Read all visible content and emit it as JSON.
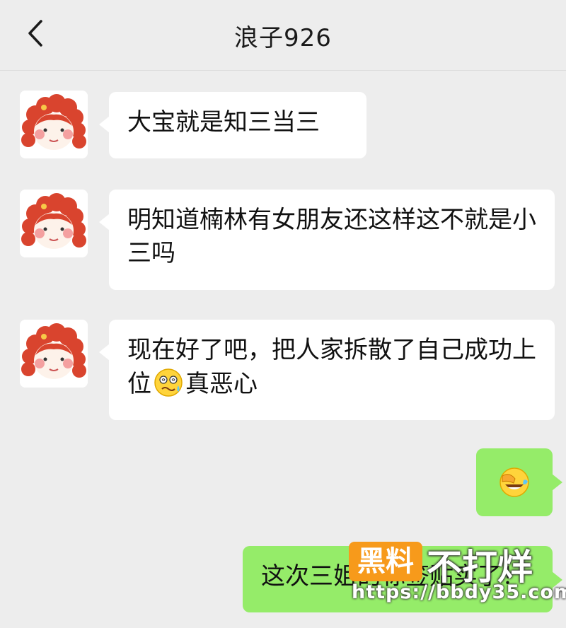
{
  "header": {
    "title": "浪子926"
  },
  "messages": [
    {
      "side": "left",
      "text": "大宝就是知三当三"
    },
    {
      "side": "left",
      "text": "明知道楠林有女朋友还这样这不就是小三吗"
    },
    {
      "side": "left",
      "text_before": "现在好了吧，把人家拆散了自己成功上位",
      "emoji": "dizzy-sweat-face-emoji",
      "text_after": "真恶心"
    },
    {
      "side": "right",
      "emoji": "facepalm-laugh-emoji"
    },
    {
      "side": "right",
      "text": "这次三姐的标签贴实了！"
    }
  ],
  "watermark": {
    "badge": "黑料",
    "text": "不打烊",
    "url": "https://bbdy35.com"
  }
}
